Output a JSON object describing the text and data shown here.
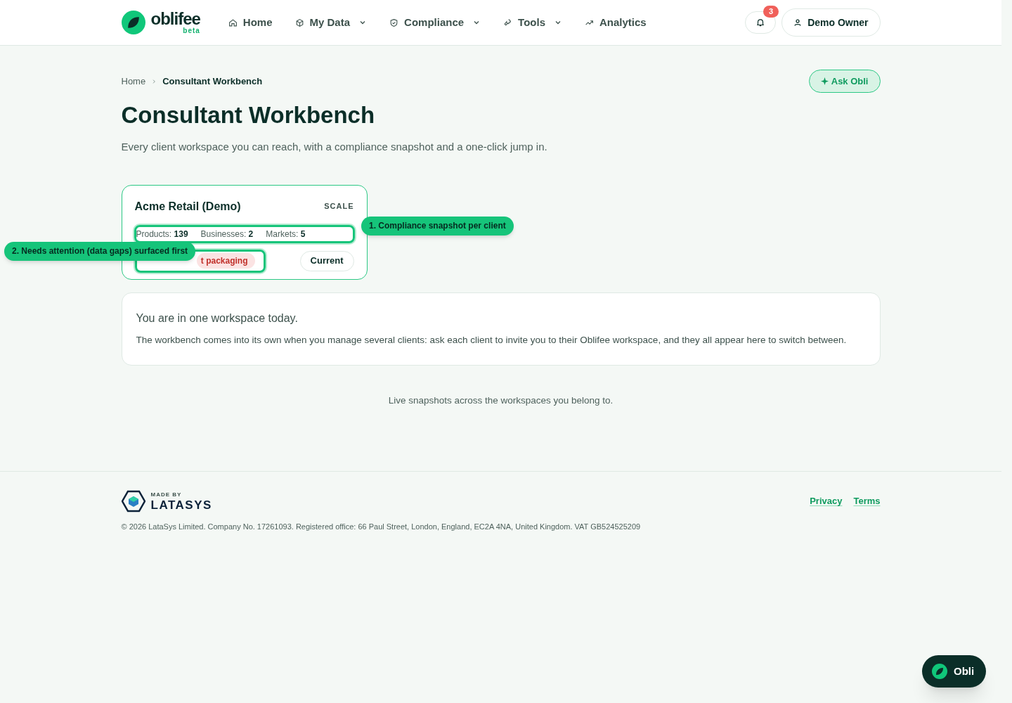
{
  "header": {
    "logo": {
      "name": "oblifee",
      "tag": "beta"
    },
    "nav": [
      {
        "label": "Home",
        "has_menu": false
      },
      {
        "label": "My Data",
        "has_menu": true
      },
      {
        "label": "Compliance",
        "has_menu": true
      },
      {
        "label": "Tools",
        "has_menu": true
      },
      {
        "label": "Analytics",
        "has_menu": false
      }
    ],
    "notifications": {
      "count": "3"
    },
    "user": {
      "name": "Demo Owner"
    }
  },
  "breadcrumb": [
    {
      "label": "Home"
    },
    {
      "label": "Consultant Workbench"
    }
  ],
  "ask_button": "Ask Obli",
  "title": "Consultant Workbench",
  "subtitle": "Every client workspace you can reach, with a compliance snapshot and a one-click jump in.",
  "clients": [
    {
      "name": "Acme Retail (Demo)",
      "plan": "SCALE",
      "stats": [
        {
          "label": "Products:",
          "value": "139"
        },
        {
          "label": "Businesses:",
          "value": "2"
        },
        {
          "label": "Markets:",
          "value": "5"
        }
      ],
      "alert": "t packaging",
      "current_label": "Current",
      "current": true
    }
  ],
  "tour": [
    {
      "text": "1. Compliance snapshot per client"
    },
    {
      "text": "2. Needs attention (data gaps) surfaced first"
    }
  ],
  "notice": {
    "title": "You are in one workspace today.",
    "body": "The workbench comes into its own when you manage several clients: ask each client to invite you to their Oblifee workspace, and they all appear here to switch between."
  },
  "footnote": "Live snapshots across the workspaces you belong to.",
  "footer": {
    "made_by": "MADE BY",
    "brand": "LATASYS",
    "links": [
      "Privacy",
      "Terms"
    ],
    "legal": "© 2026 LataSys Limited. Company No. 17261093. Registered office: 66 Paul Street, London, England, EC2A 4NA, United Kingdom. VAT GB524525209"
  },
  "fab": "Obli"
}
